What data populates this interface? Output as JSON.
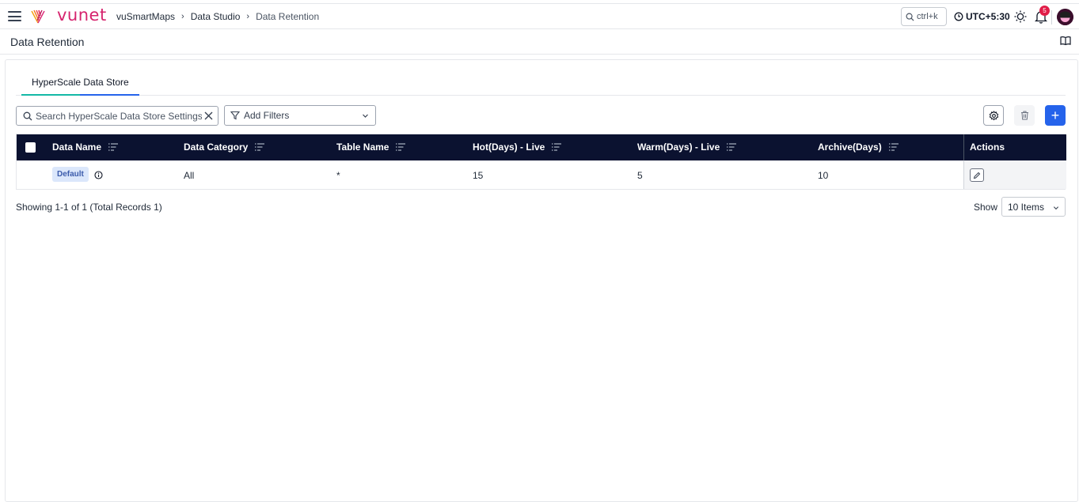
{
  "app": {
    "brand": "vunet",
    "search_shortcut": "ctrl+k",
    "timezone": "UTC+5:30",
    "notification_count": "5",
    "accent": "#2563eb",
    "header_bg": "#0b1230"
  },
  "breadcrumb": [
    "vuSmartMaps",
    "Data Studio",
    "Data Retention"
  ],
  "page": {
    "title": "Data Retention"
  },
  "tabs": [
    {
      "label": "HyperScale Data Store",
      "active": true
    }
  ],
  "toolbar": {
    "search_placeholder": "Search HyperScale Data Store Settings",
    "filters_label": "Add Filters",
    "add_label": "+"
  },
  "table": {
    "columns": [
      "Data Name",
      "Data Category",
      "Table Name",
      "Hot(Days) - Live",
      "Warm(Days) - Live",
      "Archive(Days)",
      "Actions"
    ],
    "rows": [
      {
        "data_name": "Default",
        "data_category": "All",
        "table_name": "*",
        "hot_days": "15",
        "warm_days": "5",
        "archive_days": "10"
      }
    ]
  },
  "footer": {
    "summary": "Showing 1-1 of 1 (Total Records 1)",
    "show_label": "Show",
    "page_size": "10 Items"
  },
  "icons": [
    "hamburger-icon",
    "vunet-logo-icon",
    "search-icon",
    "clock-icon",
    "sun-icon",
    "bell-icon",
    "avatar-icon",
    "book-icon",
    "close-icon",
    "filter-icon",
    "chevron-down-icon",
    "gear-icon",
    "trash-icon",
    "plus-icon",
    "sort-icon",
    "info-icon",
    "pencil-icon"
  ]
}
